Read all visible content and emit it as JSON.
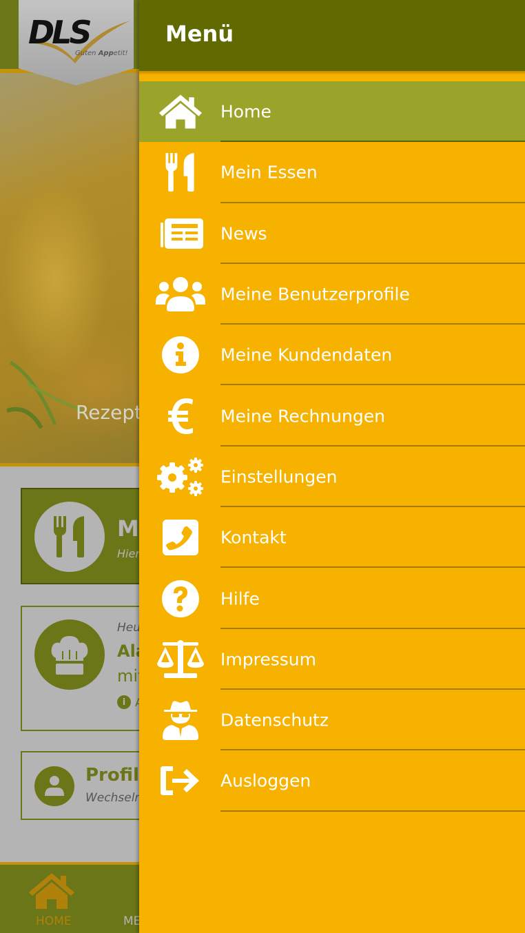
{
  "app": {
    "logo": {
      "mark": "DLS",
      "tagline_prefix": "Guten ",
      "tagline_bold": "App",
      "tagline_suffix": "etit!"
    },
    "hero": {
      "caption": "Rezept"
    },
    "cards": {
      "food": {
        "icon": "cutlery-icon",
        "title": "Me",
        "subtitle": "Hier"
      },
      "chef": {
        "icon": "chef-hat-icon",
        "overline": "Heu",
        "title": "Ala",
        "line": "mit",
        "info": "A"
      },
      "profile": {
        "icon": "user-icon",
        "title": "Profil",
        "subtitle": "Wechseln"
      }
    },
    "bottom_nav": [
      {
        "label": "HOME",
        "icon": "home-icon",
        "active": true
      },
      {
        "label": "ME",
        "icon": "",
        "active": false
      }
    ]
  },
  "drawer": {
    "title": "Menü",
    "items": [
      {
        "label": "Home",
        "icon": "home-icon",
        "active": true
      },
      {
        "label": "Mein Essen",
        "icon": "cutlery-icon",
        "active": false
      },
      {
        "label": "News",
        "icon": "newspaper-icon",
        "active": false
      },
      {
        "label": "Meine Benutzerprofile",
        "icon": "users-icon",
        "active": false
      },
      {
        "label": "Meine Kundendaten",
        "icon": "info-circle-icon",
        "active": false
      },
      {
        "label": "Meine Rechnungen",
        "icon": "euro-icon",
        "active": false
      },
      {
        "label": "Einstellungen",
        "icon": "cogs-icon",
        "active": false
      },
      {
        "label": "Kontakt",
        "icon": "phone-square-icon",
        "active": false
      },
      {
        "label": "Hilfe",
        "icon": "question-circle-icon",
        "active": false
      },
      {
        "label": "Impressum",
        "icon": "balance-scale-icon",
        "active": false
      },
      {
        "label": "Datenschutz",
        "icon": "user-secret-icon",
        "active": false
      },
      {
        "label": "Ausloggen",
        "icon": "sign-out-icon",
        "active": false
      }
    ]
  },
  "colors": {
    "drawer_bg": "#f7b200",
    "drawer_header": "#606a00",
    "active_item": "#9aa42a",
    "app_green": "#6b7618",
    "accent_orange": "#c4930c"
  }
}
